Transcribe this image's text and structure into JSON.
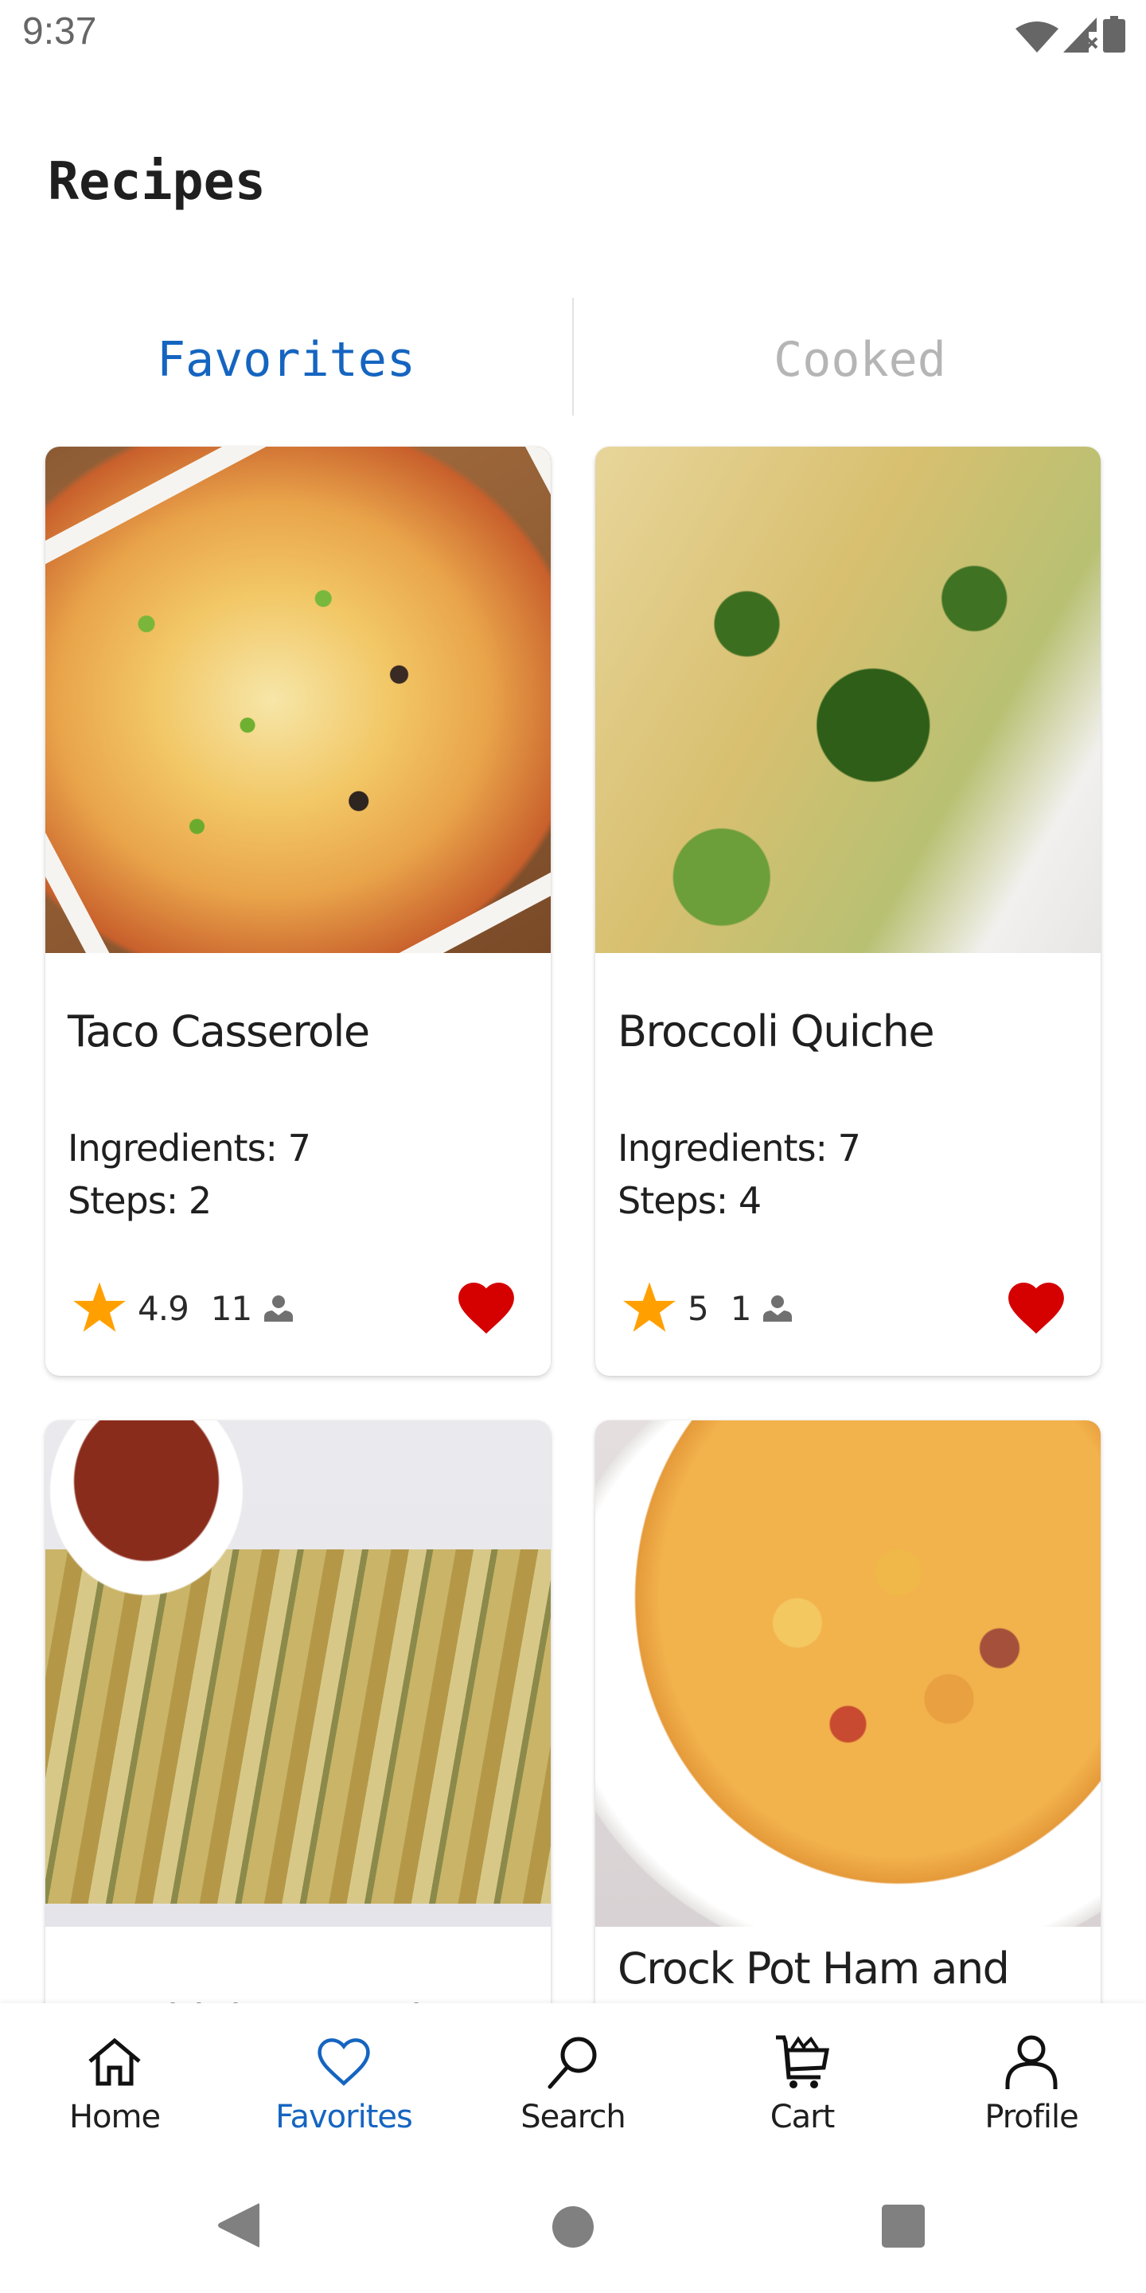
{
  "status_bar": {
    "time": "9:37",
    "icons": [
      "wifi-icon",
      "cell-signal-no-data-icon",
      "battery-icon"
    ]
  },
  "header": {
    "title": "Recipes"
  },
  "tabs": [
    {
      "label": "Favorites",
      "active": true
    },
    {
      "label": "Cooked",
      "active": false
    }
  ],
  "recipes": [
    {
      "title": "Taco Casserole",
      "ingredients_label": "Ingredients: 7",
      "steps_label": "Steps: 2",
      "rating": "4.9",
      "cook_count": "11",
      "favorited": true,
      "image": "taco-casserole-photo"
    },
    {
      "title": "Broccoli Quiche",
      "ingredients_label": "Ingredients: 7",
      "steps_label": "Steps: 4",
      "rating": "5",
      "cook_count": "1",
      "favorited": true,
      "image": "broccoli-quiche-photo"
    },
    {
      "title": "Zucchini Oven Fries",
      "image": "zucchini-oven-fries-photo"
    },
    {
      "title": "Crock Pot Ham and",
      "image": "crock-pot-ham-photo"
    }
  ],
  "bottom_nav": [
    {
      "label": "Home",
      "icon": "home-icon",
      "active": false
    },
    {
      "label": "Favorites",
      "icon": "heart-outline-icon",
      "active": true
    },
    {
      "label": "Search",
      "icon": "search-icon",
      "active": false
    },
    {
      "label": "Cart",
      "icon": "cart-icon",
      "active": false
    },
    {
      "label": "Profile",
      "icon": "person-outline-icon",
      "active": false
    }
  ],
  "system_nav": [
    "back-button",
    "home-button",
    "recents-button"
  ],
  "colors": {
    "accent": "#1565c0",
    "tab_inactive": "#b5b5b5",
    "star": "#ffa000",
    "heart": "#d50000",
    "text": "#1f1f1f",
    "status_icon": "#666666",
    "system_nav_icon": "#808080"
  }
}
